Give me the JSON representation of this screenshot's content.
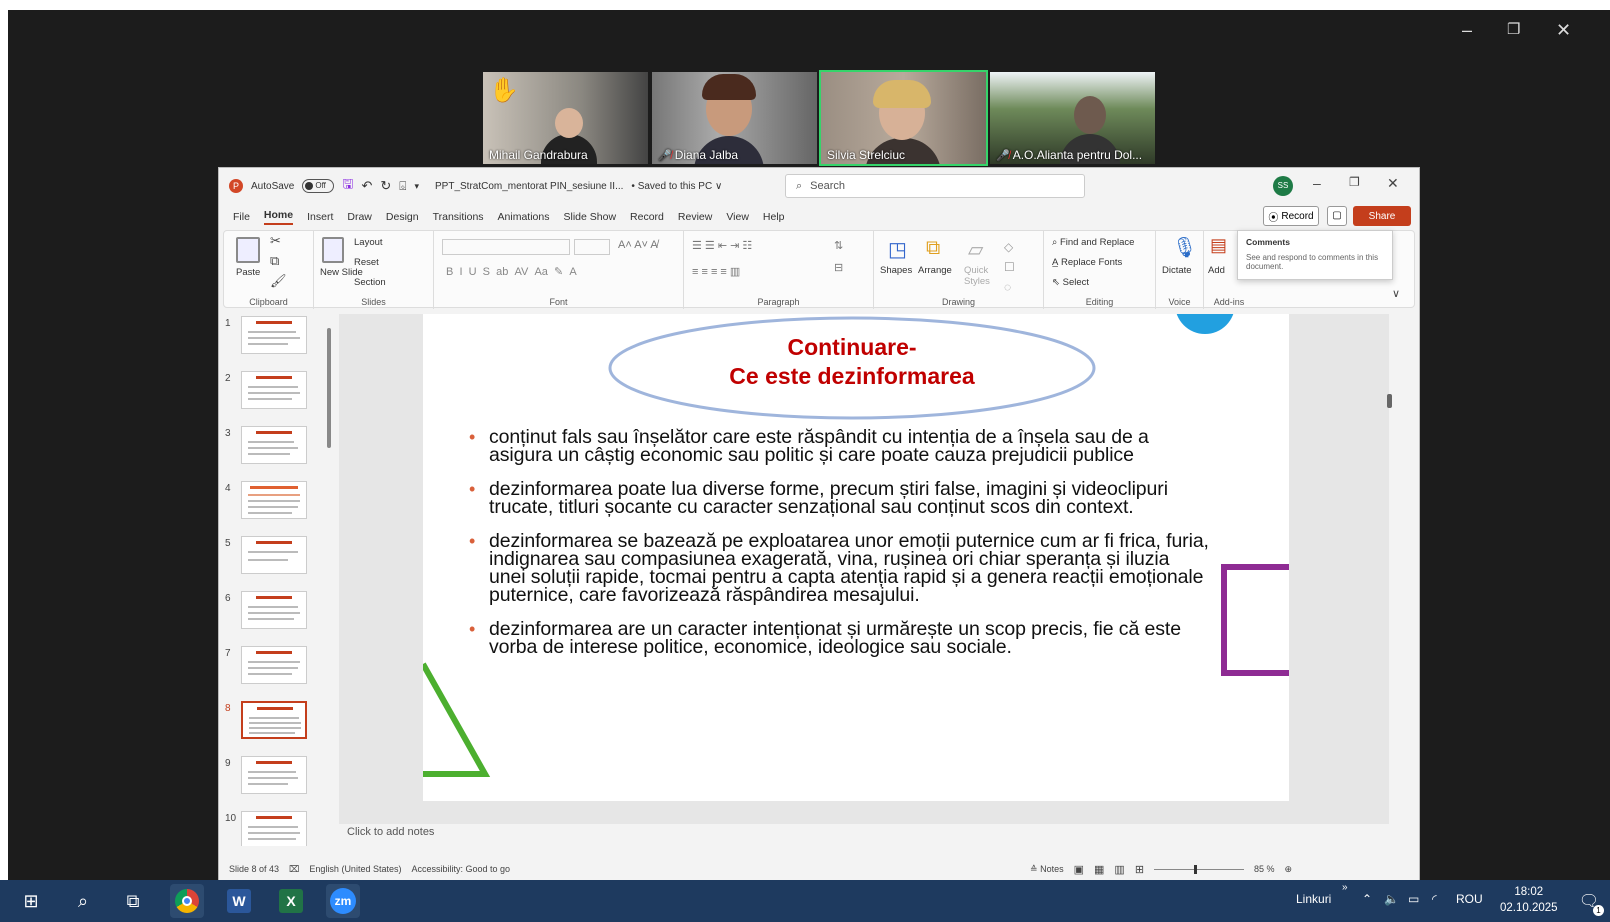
{
  "window_controls": {
    "minimize": "–",
    "restore": "❐",
    "close": "✕"
  },
  "participants": [
    {
      "name": "Mihail Gandrabura",
      "hand_raised": true,
      "muted": false,
      "active": false
    },
    {
      "name": "Diana Jalba",
      "hand_raised": false,
      "muted": true,
      "active": false
    },
    {
      "name": "Silvia Strelciuc",
      "hand_raised": false,
      "muted": false,
      "active": true
    },
    {
      "name": "A.O.Alianta pentru Dol...",
      "hand_raised": false,
      "muted": true,
      "active": false
    }
  ],
  "ppt": {
    "autosave_label": "AutoSave",
    "autosave_state": "Off",
    "file_name": "PPT_StratCom_mentorat PIN_sesiune II...",
    "save_status": "• Saved to this PC ∨",
    "search_placeholder": "Search",
    "avatar_initials": "SS",
    "menu": [
      "File",
      "Home",
      "Insert",
      "Draw",
      "Design",
      "Transitions",
      "Animations",
      "Slide Show",
      "Record",
      "Review",
      "View",
      "Help"
    ],
    "active_menu": "Home",
    "record_label": "Record",
    "share_label": "Share",
    "ribbon": {
      "clipboard": {
        "paste": "Paste",
        "label": "Clipboard"
      },
      "slides": {
        "new_slide": "New Slide",
        "layout": "Layout",
        "reset": "Reset",
        "section": "Section",
        "label": "Slides"
      },
      "font": {
        "label": "Font"
      },
      "paragraph": {
        "label": "Paragraph"
      },
      "drawing": {
        "shapes": "Shapes",
        "arrange": "Arrange",
        "quick_styles": "Quick Styles",
        "label": "Drawing"
      },
      "editing": {
        "find_replace": "Find and Replace",
        "replace_fonts": "Replace Fonts",
        "select": "Select",
        "label": "Editing"
      },
      "voice": {
        "dictate": "Dictate",
        "label": "Voice"
      },
      "addins": {
        "add": "Add",
        "label": "Add-ins"
      }
    },
    "tooltip": {
      "title": "Comments",
      "description": "See and respond to comments in this document."
    },
    "thumbnails": [
      1,
      2,
      3,
      4,
      5,
      6,
      7,
      8,
      9,
      10
    ],
    "active_slide": 8,
    "slide": {
      "title_line1": "Continuare-",
      "title_line2": "Ce este dezinformarea",
      "bullets": [
        "conținut fals sau înșelător care este răspândit cu intenția de a înșela sau de a asigura un câștig economic sau politic și care poate cauza prejudicii publice",
        "dezinformarea poate lua diverse forme, precum știri false, imagini și videoclipuri trucate, titluri șocante cu caracter senzațional sau conținut scos din context.",
        "dezinformarea se bazează pe exploatarea unor emoții puternice cum ar fi frica, furia, indignarea sau compasiunea exagerată, vina, rușinea ori chiar speranța și iluzia unei soluții rapide, tocmai pentru a capta atenția rapid și a genera reacții emoționale puternice, care favorizează răspândirea mesajului.",
        "dezinformarea are un caracter intenționat și urmărește un scop precis, fie că este vorba de interese politice, economice, ideologice sau sociale."
      ]
    },
    "notes_placeholder": "Click to add notes",
    "status": {
      "slide_count": "Slide 8 of 43",
      "language": "English (United States)",
      "accessibility": "Accessibility: Good to go",
      "notes": "Notes",
      "zoom": "85 %"
    }
  },
  "taskbar": {
    "linkuri": "Linkuri",
    "language": "ROU",
    "time": "18:02",
    "date": "02.10.2025",
    "notification_count": "1"
  }
}
